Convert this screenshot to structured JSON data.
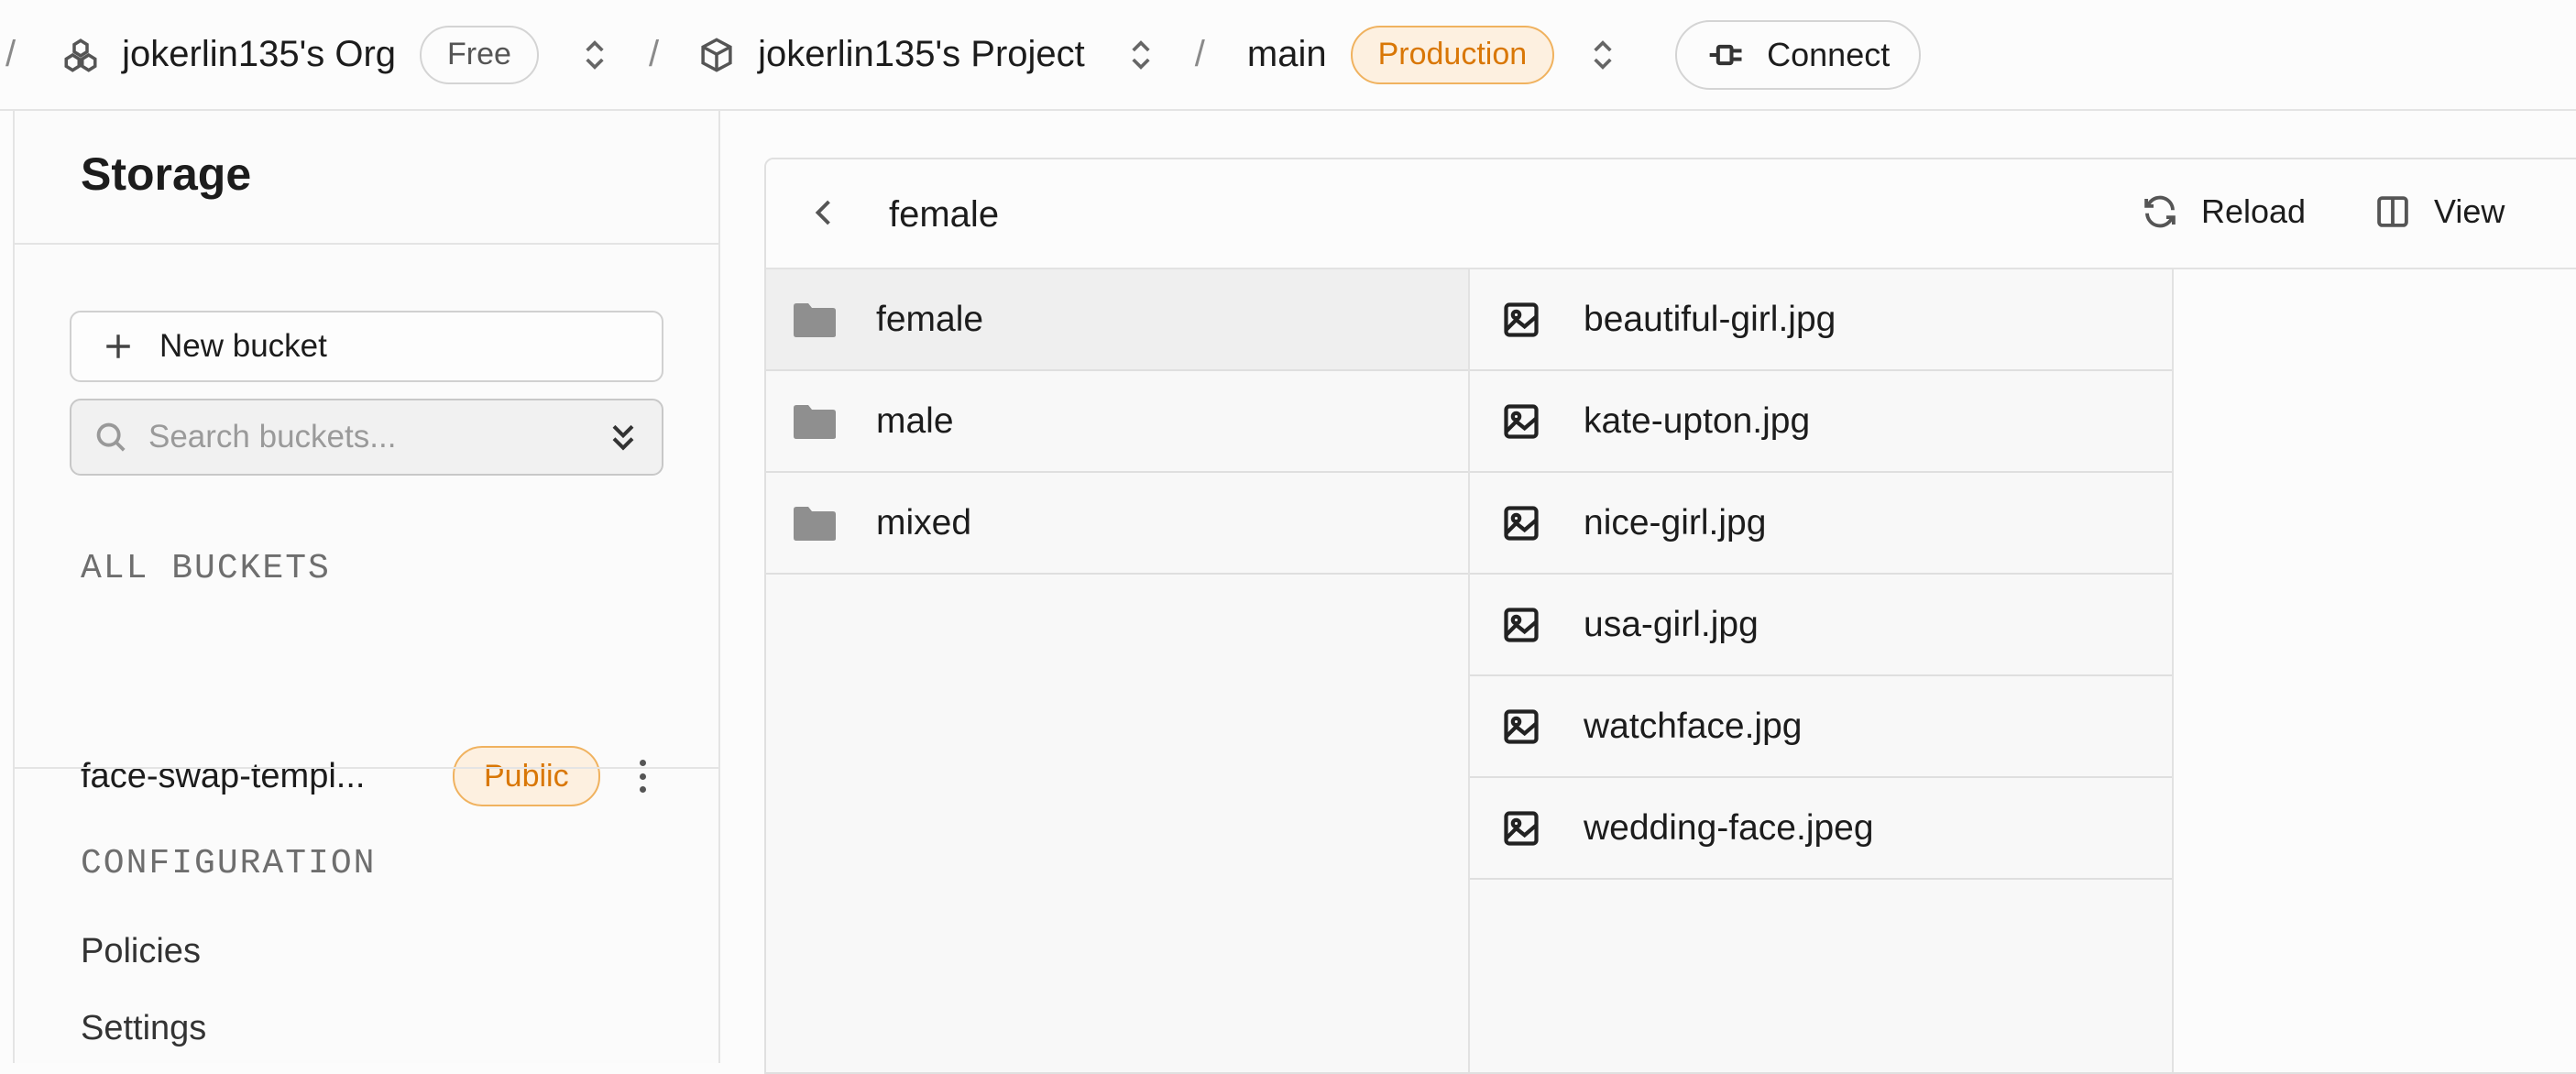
{
  "topbar": {
    "org_name": "jokerlin135's Org",
    "org_plan": "Free",
    "project_name": "jokerlin135's Project",
    "branch": "main",
    "environment": "Production",
    "connect_label": "Connect",
    "separator": "/"
  },
  "sidebar": {
    "title": "Storage",
    "new_bucket_label": "New bucket",
    "search_placeholder": "Search buckets...",
    "all_buckets_label": "ALL BUCKETS",
    "buckets": [
      {
        "name": "face-swap-templ...",
        "badge": "Public"
      }
    ],
    "configuration_label": "CONFIGURATION",
    "config_items": [
      "Policies",
      "Settings"
    ]
  },
  "explorer": {
    "current_path": "female",
    "reload_label": "Reload",
    "view_label": "View",
    "folders": [
      {
        "name": "female",
        "selected": true
      },
      {
        "name": "male",
        "selected": false
      },
      {
        "name": "mixed",
        "selected": false
      }
    ],
    "files": [
      {
        "name": "beautiful-girl.jpg"
      },
      {
        "name": "kate-upton.jpg"
      },
      {
        "name": "nice-girl.jpg"
      },
      {
        "name": "usa-girl.jpg"
      },
      {
        "name": "watchface.jpg"
      },
      {
        "name": "wedding-face.jpeg"
      }
    ]
  },
  "icons": {
    "org": "org-icon",
    "project": "cube-icon",
    "connect": "plug-icon",
    "folder": "folder-icon",
    "file": "image-icon",
    "reload": "reload-icon",
    "view": "columns-icon",
    "back": "chevron-left-icon",
    "search": "search-icon",
    "switcher": "chevron-updown-icon"
  },
  "colors": {
    "accent_orange": "#d97706",
    "badge_orange_bg": "#fdf0e0",
    "border": "#e2e2e2",
    "text": "#1c1c1c"
  }
}
